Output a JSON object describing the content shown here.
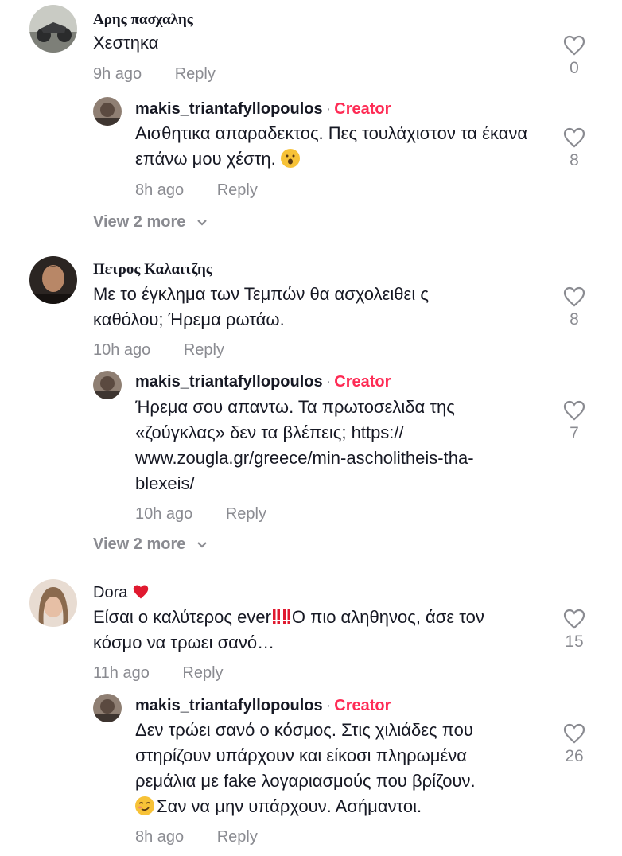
{
  "comments": [
    {
      "username": "Αρης πασχαλης",
      "text": "Χεστηκα",
      "time": "9h ago",
      "reply_label": "Reply",
      "likes": "0",
      "reply": {
        "username": "makis_triantafyllopoulos",
        "creator_label": "Creator",
        "separator": "·",
        "text": "Αισθητικα απαραδεκτος. Πες τουλάχιστον τα έκανα επάνω μου χέστη.",
        "time": "8h ago",
        "reply_label": "Reply",
        "likes": "8"
      },
      "view_more": "View 2 more"
    },
    {
      "username": "Πετρος Καλαιτζης",
      "text": "Με το έγκλημα των Τεμπών θα ασχολειθει ς καθόλου; Ήρεμα ρωτάω.",
      "time": "10h ago",
      "reply_label": "Reply",
      "likes": "8",
      "reply": {
        "username": "makis_triantafyllopoulos",
        "creator_label": "Creator",
        "separator": "·",
        "text_line1": "Ήρεμα σου απαντω. Τα πρωτοσελιδα της",
        "text_line2": "«ζούγκλας» δεν τα βλέπεις; https://",
        "text_line3": "www.zougla.gr/greece/min-ascholitheis-tha-",
        "text_line4": "blexeis/",
        "time": "10h ago",
        "reply_label": "Reply",
        "likes": "7"
      },
      "view_more": "View 2 more"
    },
    {
      "username": "Dora",
      "text_part1": "Είσαι ο καλύτερος ever",
      "text_part2": "Ο πιο αληθηνος, άσε τον",
      "text_line2": "κόσμο να τρωει σανό…",
      "time": "11h ago",
      "reply_label": "Reply",
      "likes": "15",
      "reply": {
        "username": "makis_triantafyllopoulos",
        "creator_label": "Creator",
        "separator": "·",
        "text_line1": "Δεν τρώει σανό ο κόσμος. Στις χιλιάδες που",
        "text_line2": "στηρίζουν υπάρχουν και είκοσι πληρωμένα",
        "text_line3": "ρεμάλια με fake λογαριασμούς που βρίζουν.",
        "text_line4": "Σαν να μην υπάρχουν. Ασήμαντοι.",
        "time": "8h ago",
        "reply_label": "Reply",
        "likes": "26"
      }
    }
  ],
  "colors": {
    "creator": "#fe2c55",
    "secondary": "#8a8b91",
    "text": "#161823"
  },
  "icons": [
    "heart-outline-icon",
    "chevron-down-icon",
    "red-heart-emoji",
    "double-exclamation-emoji",
    "face-emoji"
  ]
}
